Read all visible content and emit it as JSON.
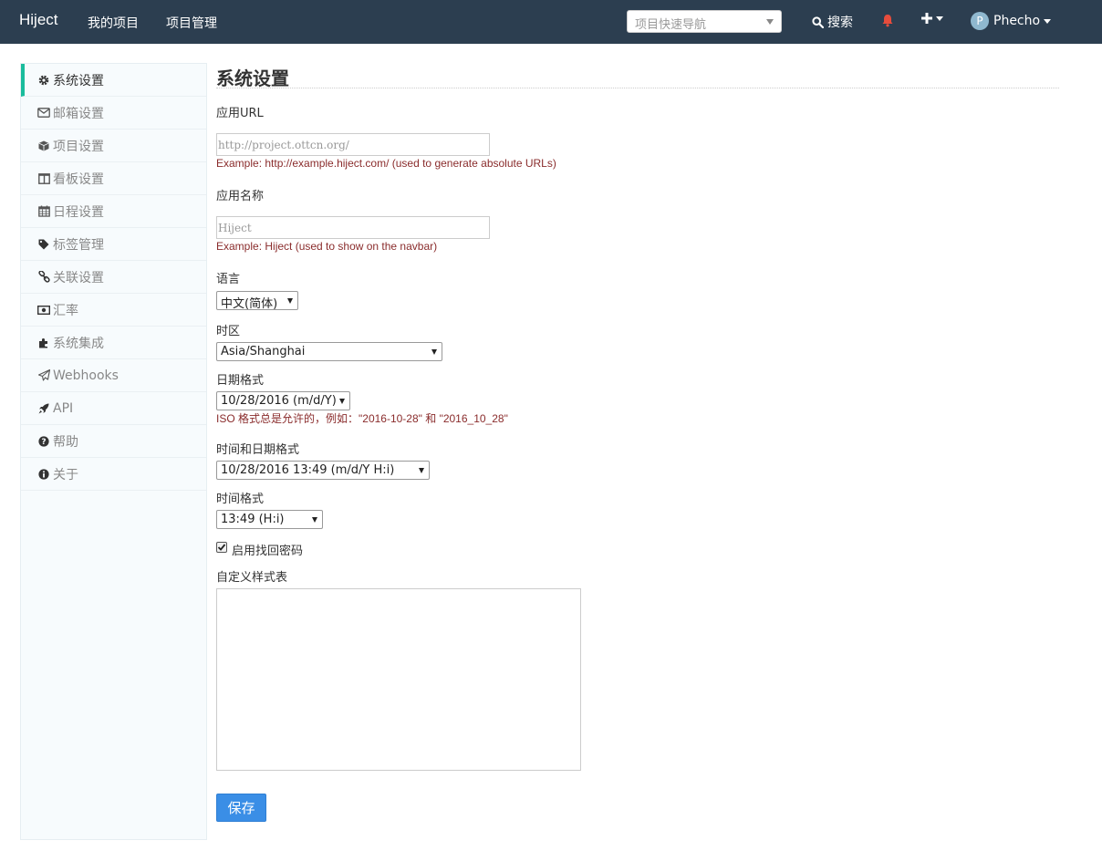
{
  "navbar": {
    "brand": "Hiject",
    "links": [
      "我的项目",
      "项目管理"
    ],
    "quick_nav_placeholder": "项目快速导航",
    "search_label": "搜索",
    "user_initial": "P",
    "user_name": "Phecho"
  },
  "sidebar": {
    "items": [
      {
        "label": "系统设置",
        "icon": "gear-icon",
        "active": true
      },
      {
        "label": "邮箱设置",
        "icon": "envelope-icon"
      },
      {
        "label": "项目设置",
        "icon": "cube-icon"
      },
      {
        "label": "看板设置",
        "icon": "columns-icon"
      },
      {
        "label": "日程设置",
        "icon": "calendar-icon"
      },
      {
        "label": "标签管理",
        "icon": "tag-icon"
      },
      {
        "label": "关联设置",
        "icon": "link-icon"
      },
      {
        "label": "汇率",
        "icon": "money-icon"
      },
      {
        "label": "系统集成",
        "icon": "puzzle-icon"
      },
      {
        "label": "Webhooks",
        "icon": "paper-plane-icon"
      },
      {
        "label": "API",
        "icon": "rocket-icon"
      },
      {
        "label": "帮助",
        "icon": "question-icon"
      },
      {
        "label": "关于",
        "icon": "info-icon"
      }
    ]
  },
  "main": {
    "title": "系统设置",
    "app_url": {
      "label": "应用URL",
      "placeholder": "http://project.ottcn.org/",
      "help": "Example: http://example.hiject.com/ (used to generate absolute URLs)"
    },
    "app_name": {
      "label": "应用名称",
      "placeholder": "Hiject",
      "help": "Example: Hiject (used to show on the navbar)"
    },
    "language": {
      "label": "语言",
      "value": "中文(简体)"
    },
    "timezone": {
      "label": "时区",
      "value": "Asia/Shanghai"
    },
    "date_format": {
      "label": "日期格式",
      "value": "10/28/2016 (m/d/Y)",
      "help": "ISO 格式总是允许的，例如：\"2016-10-28\" 和 \"2016_10_28\""
    },
    "datetime_format": {
      "label": "时间和日期格式",
      "value": "10/28/2016 13:49 (m/d/Y H:i)"
    },
    "time_format": {
      "label": "时间格式",
      "value": "13:49 (H:i)"
    },
    "password_reset": {
      "label": "启用找回密码",
      "checked": true
    },
    "custom_css": {
      "label": "自定义样式表",
      "value": ""
    },
    "save_label": "保存"
  }
}
